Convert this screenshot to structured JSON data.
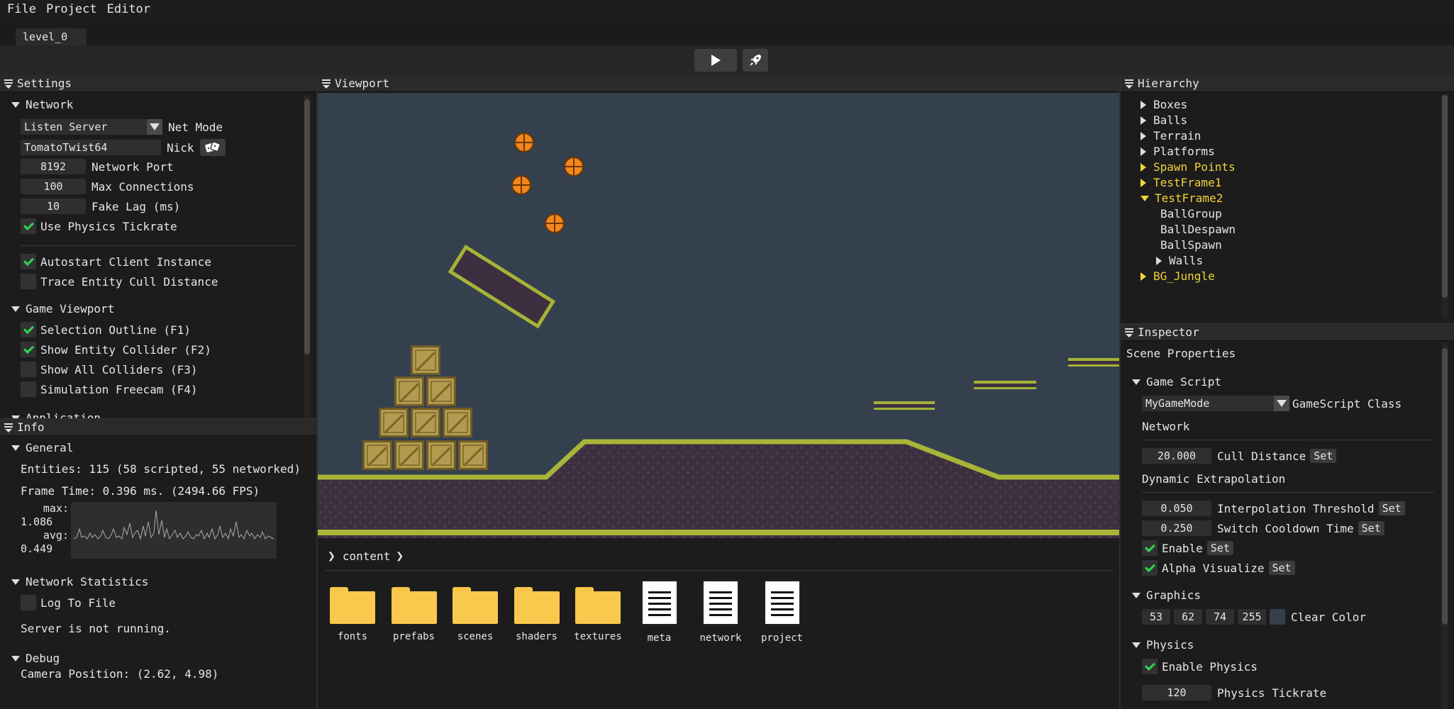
{
  "menu": {
    "items": [
      "File",
      "Project",
      "Editor"
    ]
  },
  "tabs": {
    "level": "level_0"
  },
  "toolbar": {
    "play_icon": "play-icon",
    "launch_icon": "rocket-icon"
  },
  "settings": {
    "title": "Settings",
    "network_section": "Network",
    "net_mode_value": "Listen Server",
    "net_mode_label": "Net Mode",
    "nick_value": "TomatoTwist64",
    "nick_label": "Nick",
    "port_value": "8192",
    "port_label": "Network Port",
    "max_conn_value": "100",
    "max_conn_label": "Max Connections",
    "fake_lag_value": "10",
    "fake_lag_label": "Fake Lag (ms)",
    "use_physics_tickrate": "Use Physics Tickrate",
    "autostart_client": "Autostart Client Instance",
    "trace_cull": "Trace Entity Cull Distance",
    "game_viewport_section": "Game Viewport",
    "selection_outline": "Selection Outline (F1)",
    "show_entity_collider": "Show Entity Collider (F2)",
    "show_all_colliders": "Show All Colliders (F3)",
    "simulation_freecam": "Simulation Freecam (F4)",
    "application_section": "Application"
  },
  "info": {
    "title": "Info",
    "general_section": "General",
    "entities": "Entities: 115 (58 scripted, 55 networked)",
    "frame_time": "Frame Time: 0.396 ms. (2494.66 FPS)",
    "max_label": "max:",
    "max_value": "1.086",
    "avg_label": "avg:",
    "avg_value": "0.449",
    "net_stats_section": "Network Statistics",
    "log_to_file": "Log To File",
    "server_status": "Server is not running.",
    "debug_section": "Debug",
    "camera_position": "Camera Position: (2.62, 4.98)"
  },
  "viewport": {
    "title": "Viewport"
  },
  "content_browser": {
    "path": "content",
    "items": [
      {
        "name": "fonts",
        "type": "folder"
      },
      {
        "name": "prefabs",
        "type": "folder"
      },
      {
        "name": "scenes",
        "type": "folder"
      },
      {
        "name": "shaders",
        "type": "folder"
      },
      {
        "name": "textures",
        "type": "folder"
      },
      {
        "name": "meta",
        "type": "file"
      },
      {
        "name": "network",
        "type": "file"
      },
      {
        "name": "project",
        "type": "file"
      }
    ]
  },
  "hierarchy": {
    "title": "Hierarchy",
    "items": [
      {
        "label": "Boxes",
        "depth": 0,
        "expandable": true,
        "open": false,
        "highlight": false
      },
      {
        "label": "Balls",
        "depth": 0,
        "expandable": true,
        "open": false,
        "highlight": false
      },
      {
        "label": "Terrain",
        "depth": 0,
        "expandable": true,
        "open": false,
        "highlight": false
      },
      {
        "label": "Platforms",
        "depth": 0,
        "expandable": true,
        "open": false,
        "highlight": false
      },
      {
        "label": "Spawn Points",
        "depth": 0,
        "expandable": true,
        "open": false,
        "highlight": true
      },
      {
        "label": "TestFrame1",
        "depth": 0,
        "expandable": true,
        "open": false,
        "highlight": true
      },
      {
        "label": "TestFrame2",
        "depth": 0,
        "expandable": true,
        "open": true,
        "highlight": true
      },
      {
        "label": "BallGroup",
        "depth": 1,
        "expandable": false,
        "open": false,
        "highlight": false
      },
      {
        "label": "BallDespawn",
        "depth": 1,
        "expandable": false,
        "open": false,
        "highlight": false
      },
      {
        "label": "BallSpawn",
        "depth": 1,
        "expandable": false,
        "open": false,
        "highlight": false
      },
      {
        "label": "Walls",
        "depth": 1,
        "expandable": true,
        "open": false,
        "highlight": false
      },
      {
        "label": "BG_Jungle",
        "depth": 0,
        "expandable": true,
        "open": false,
        "highlight": true
      }
    ]
  },
  "inspector": {
    "title": "Inspector",
    "scene_properties": "Scene Properties",
    "game_script_section": "Game Script",
    "game_script_value": "MyGameMode",
    "game_script_label": "GameScript Class",
    "network_label": "Network",
    "cull_distance_value": "20.000",
    "cull_distance_label": "Cull Distance",
    "dyn_extrap_label": "Dynamic Extrapolation",
    "interp_threshold_value": "0.050",
    "interp_threshold_label": "Interpolation Threshold",
    "switch_cooldown_value": "0.250",
    "switch_cooldown_label": "Switch Cooldown Time",
    "enable_label": "Enable",
    "alpha_visualize_label": "Alpha Visualize",
    "set_label": "Set",
    "graphics_section": "Graphics",
    "clear_r": "53",
    "clear_g": "62",
    "clear_b": "74",
    "clear_a": "255",
    "clear_color_label": "Clear Color",
    "clear_color_hex": "#353e4a",
    "physics_section": "Physics",
    "enable_physics_label": "Enable Physics",
    "physics_tickrate_value": "120",
    "physics_tickrate_label": "Physics Tickrate"
  }
}
